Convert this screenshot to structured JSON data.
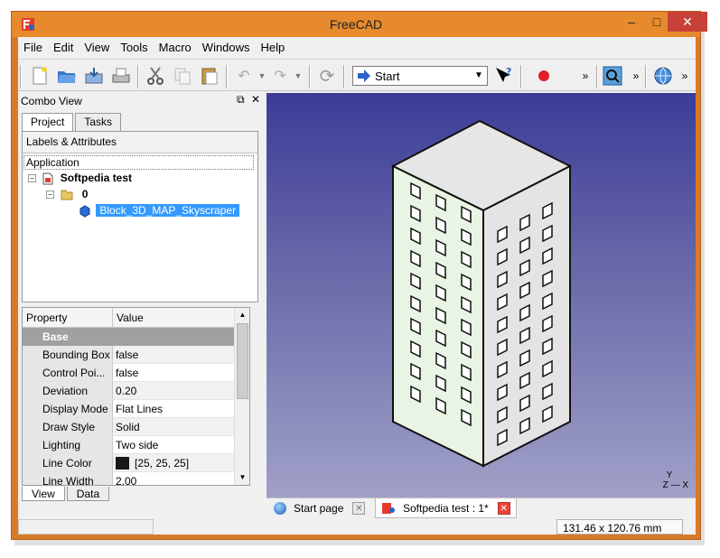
{
  "window": {
    "title": "FreeCAD"
  },
  "menu": [
    "File",
    "Edit",
    "View",
    "Tools",
    "Macro",
    "Windows",
    "Help"
  ],
  "toolbar": {
    "workbench": "Start"
  },
  "combo": {
    "title": "Combo View",
    "tabs": [
      "Project",
      "Tasks"
    ],
    "tree_header": "Labels & Attributes",
    "application": "Application",
    "document": "Softpedia test",
    "group": "0",
    "object": "Block_3D_MAP_Skyscraper"
  },
  "properties": {
    "headers": [
      "Property",
      "Value"
    ],
    "group": "Base",
    "rows": [
      {
        "name": "Bounding Box",
        "value": "false"
      },
      {
        "name": "Control Poi...",
        "value": "false"
      },
      {
        "name": "Deviation",
        "value": "0.20"
      },
      {
        "name": "Display Mode",
        "value": "Flat Lines"
      },
      {
        "name": "Draw Style",
        "value": "Solid"
      },
      {
        "name": "Lighting",
        "value": "Two side"
      },
      {
        "name": "Line Color",
        "value": "[25, 25, 25]"
      },
      {
        "name": "Line Width",
        "value": "2.00"
      }
    ],
    "tabs": [
      "View",
      "Data"
    ]
  },
  "documents": {
    "tab1": "Start page",
    "tab2": "Softpedia test : 1*"
  },
  "axis": {
    "y": "Y",
    "z": "Z",
    "x": "X"
  },
  "status": {
    "dimensions": "131.46 x 120.76 mm"
  }
}
